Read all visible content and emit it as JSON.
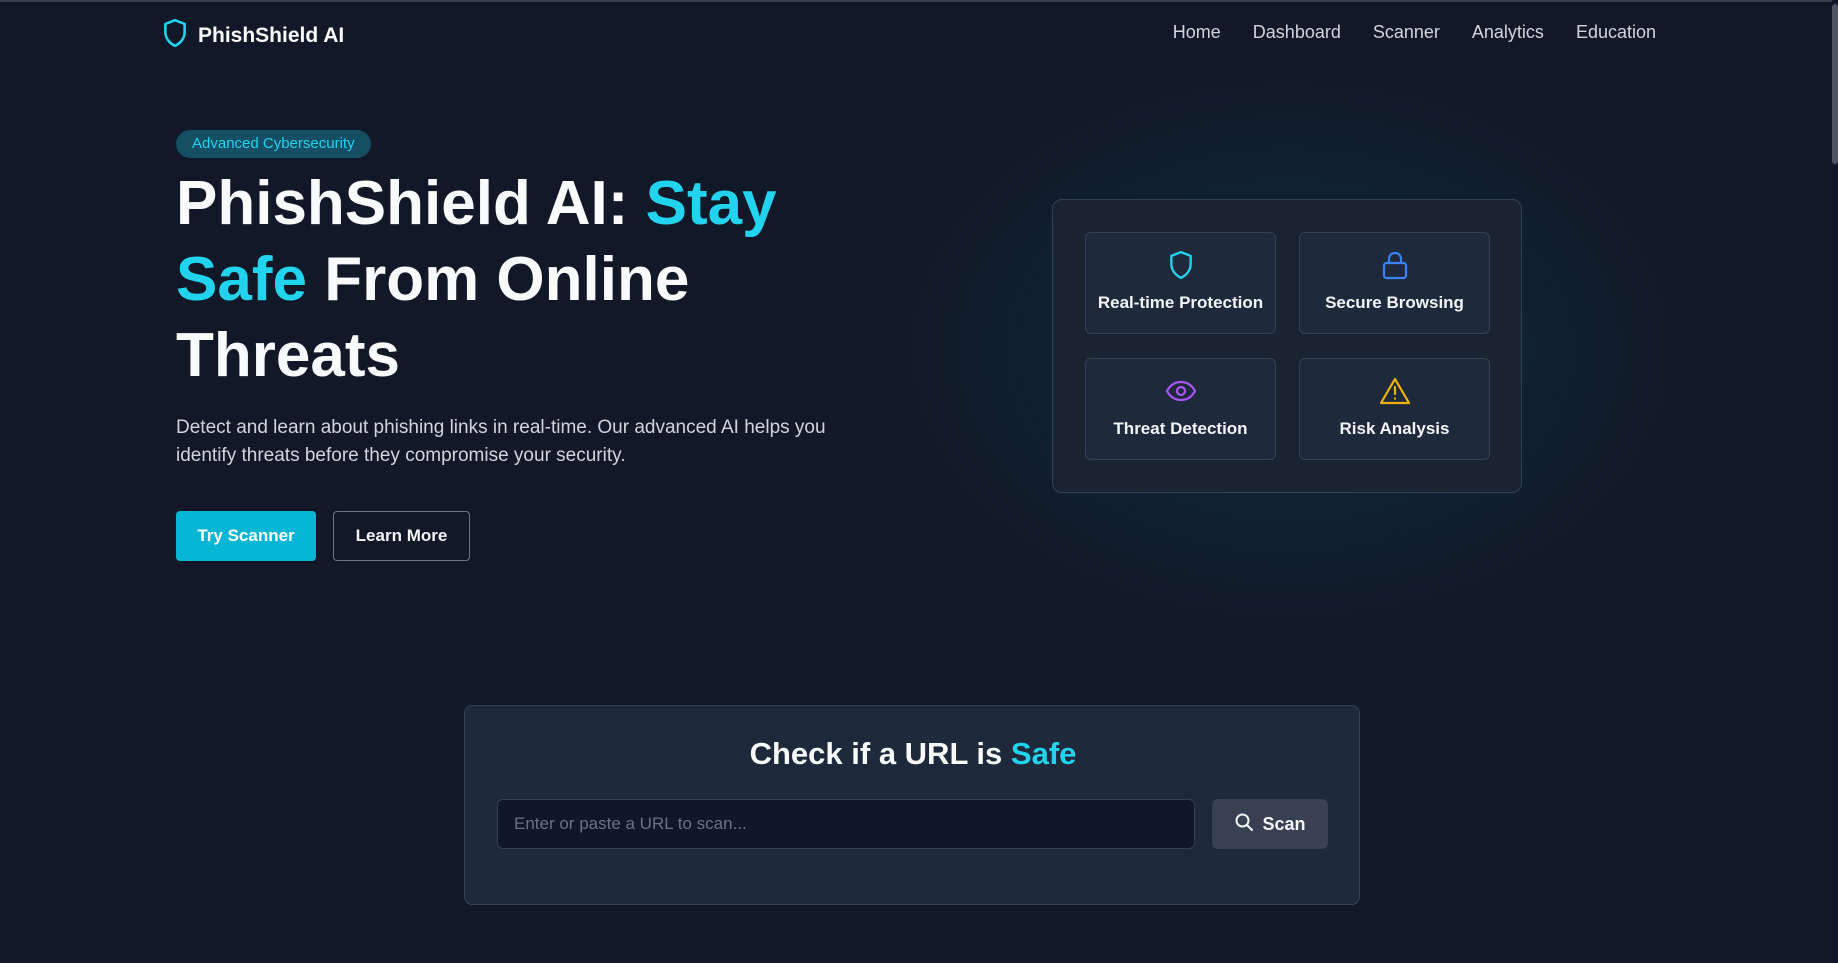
{
  "nav": {
    "brand": "PhishShield AI",
    "links": [
      "Home",
      "Dashboard",
      "Scanner",
      "Analytics",
      "Education"
    ]
  },
  "hero": {
    "badge": "Advanced Cybersecurity",
    "title_part1": "PhishShield AI: ",
    "title_highlight": "Stay Safe",
    "title_part2": " From Online Threats",
    "description": "Detect and learn about phishing links in real-time. Our advanced AI helps you identify threats before they compromise your security.",
    "primary_button": "Try Scanner",
    "secondary_button": "Learn More"
  },
  "features": [
    {
      "label": "Real-time Protection",
      "icon": "shield-icon",
      "color": "#22d3ee"
    },
    {
      "label": "Secure Browsing",
      "icon": "lock-icon",
      "color": "#3b82f6"
    },
    {
      "label": "Threat Detection",
      "icon": "eye-icon",
      "color": "#a855f7"
    },
    {
      "label": "Risk Analysis",
      "icon": "warning-icon",
      "color": "#eab308"
    }
  ],
  "scanner": {
    "title_part1": "Check if a URL is ",
    "title_highlight": "Safe",
    "placeholder": "Enter or paste a URL to scan...",
    "button": "Scan"
  },
  "colors": {
    "background": "#111827",
    "accent": "#22d3ee",
    "card": "#1e293b"
  }
}
